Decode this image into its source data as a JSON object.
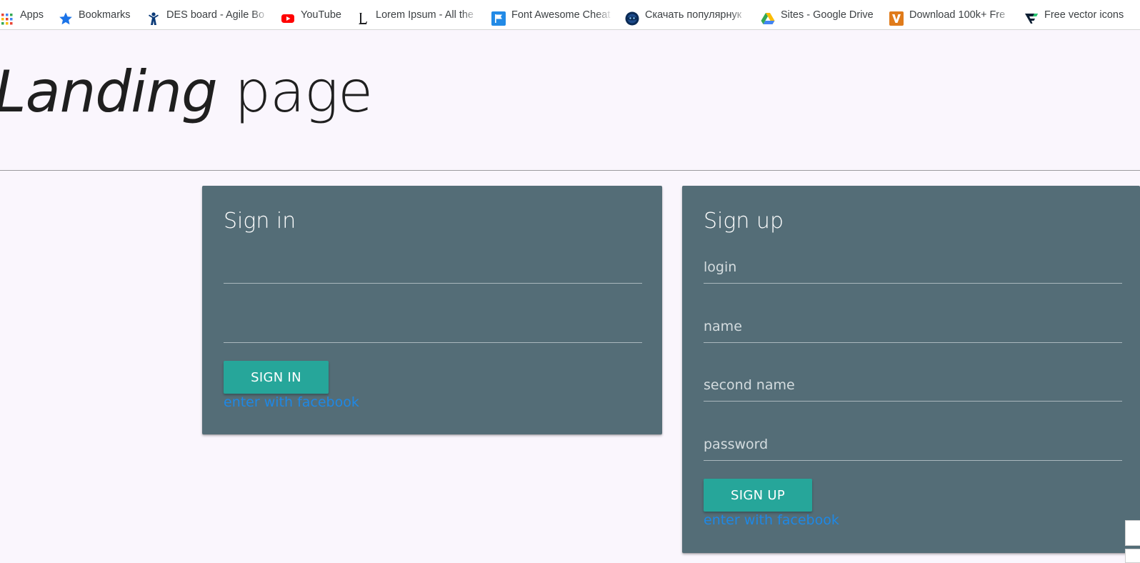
{
  "bookmarks": [
    {
      "label": "Apps",
      "icon": "apps-grid-icon"
    },
    {
      "label": "Bookmarks",
      "icon": "star-icon"
    },
    {
      "label": "DES board - Agile Bo",
      "icon": "jira-icon"
    },
    {
      "label": "YouTube",
      "icon": "youtube-icon"
    },
    {
      "label": "Lorem Ipsum - All the",
      "icon": "lorem-ipsum-icon"
    },
    {
      "label": "Font Awesome Cheat",
      "icon": "font-awesome-flag-icon"
    },
    {
      "label": "Скачать популярнук",
      "icon": "globe-icon"
    },
    {
      "label": "Sites - Google Drive",
      "icon": "google-drive-icon"
    },
    {
      "label": "Download 100k+ Fre",
      "icon": "vecteezy-icon"
    },
    {
      "label": "Free vector icons",
      "icon": "flaticon-icon"
    }
  ],
  "hero": {
    "title_italic": "Landing",
    "title_rest": " page"
  },
  "signin": {
    "title": "Sign in",
    "field1_placeholder": "",
    "field2_placeholder": "",
    "button_label": "SIGN IN",
    "facebook_link": "enter with facebook"
  },
  "signup": {
    "title": "Sign up",
    "login_placeholder": "login",
    "name_placeholder": "name",
    "second_name_placeholder": "second name",
    "password_placeholder": "password",
    "button_label": "SIGN UP",
    "facebook_link": "enter with facebook"
  },
  "colors": {
    "page_background": "#faf6fd",
    "card_background": "#546d77",
    "button": "#26a69a",
    "link": "#1e88e5"
  }
}
